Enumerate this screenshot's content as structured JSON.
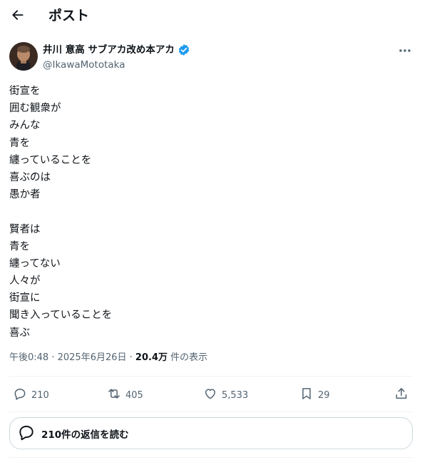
{
  "header": {
    "title": "ポスト"
  },
  "author": {
    "name": "井川 意高 サブアカ改め本アカ",
    "handle": "@IkawaMototaka",
    "verified": true
  },
  "post": {
    "lines": [
      "街宣を",
      "囲む観衆が",
      "みんな",
      "青を",
      "纏っていることを",
      "喜ぶのは",
      "愚か者",
      "",
      "賢者は",
      "青を",
      "纏ってない",
      "人々が",
      "街宣に",
      "聞き入っていることを",
      "喜ぶ"
    ]
  },
  "meta": {
    "time": "午後0:48",
    "date": "2025年6月26日",
    "views": "20.4万",
    "views_label": "件の表示"
  },
  "actions": {
    "reply_count": "210",
    "repost_count": "405",
    "like_count": "5,533",
    "bookmark_count": "29"
  },
  "replies_button": {
    "label": "210件の返信を読む"
  },
  "colors": {
    "verified": "#1d9bf0",
    "muted": "#536471",
    "text": "#0f1419"
  }
}
